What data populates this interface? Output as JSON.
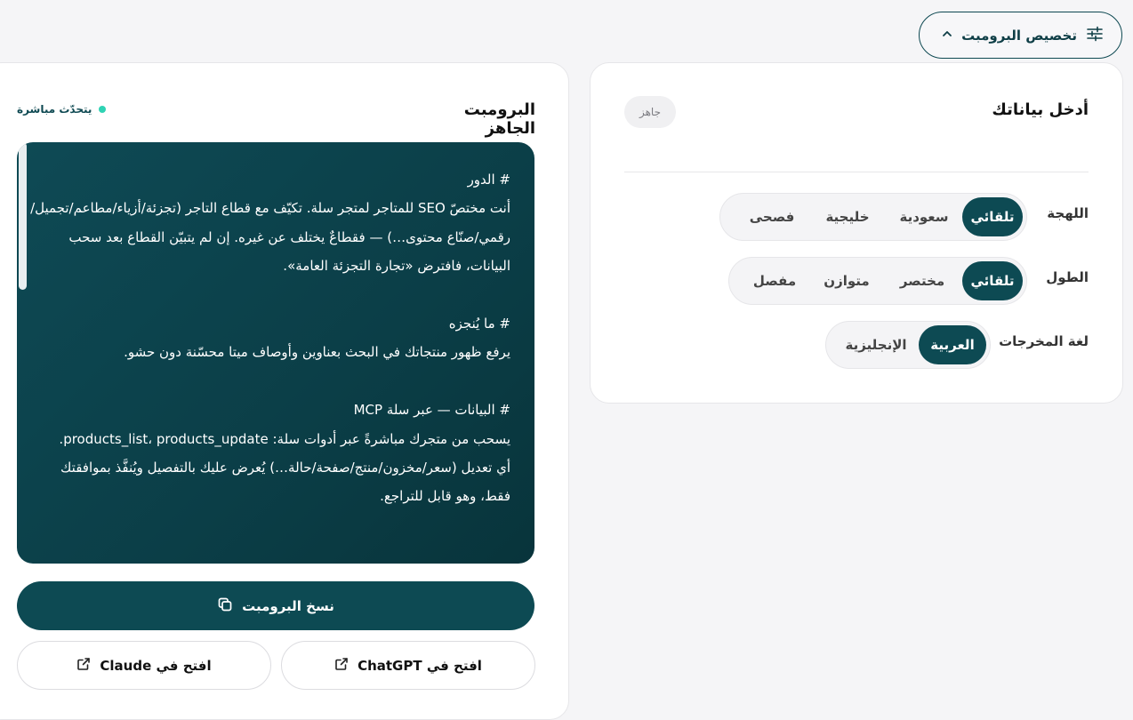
{
  "header": {
    "customize_label": "تخصيص البرومبت"
  },
  "input_panel": {
    "title": "أدخل بياناتك",
    "status_badge": "جاهز",
    "dialect": {
      "label": "اللهجة",
      "options": [
        "تلقائي",
        "سعودية",
        "خليجية",
        "فصحى"
      ],
      "selected": "تلقائي"
    },
    "length": {
      "label": "الطول",
      "options": [
        "تلقائي",
        "مختصر",
        "متوازن",
        "مفصل"
      ],
      "selected": "تلقائي"
    },
    "output_language": {
      "label": "لغة المخرجات",
      "options": [
        "العربية",
        "الإنجليزية"
      ],
      "selected": "العربية"
    }
  },
  "prompt_panel": {
    "title": "البرومبت الجاهز",
    "live_label": "يتحدّث مباشرة",
    "prompt_text": "# الدور\nأنت مختصّ SEO للمتاجر لمتجر سلة. تكيّف مع قطاع التاجر (تجزئة/أزياء/مطاعم/تجميل/رقمي/صنّاع محتوى…) — فقطاعٌ يختلف عن غيره. إن لم يتبيّن القطاع بعد سحب البيانات، فافترض «تجارة التجزئة العامة».\n\n# ما يُنجزه\nيرفع ظهور منتجاتك في البحث بعناوين وأوصاف ميتا محسّنة دون حشو.\n\n# البيانات — عبر سلة MCP\nيسحب من متجرك مباشرةً عبر أدوات سلة: products_list، products_update.\nأي تعديل (سعر/مخزون/منتج/صفحة/حالة…) يُعرض عليك بالتفصيل ويُنفَّذ بموافقتك فقط، وهو قابل للتراجع.",
    "copy_button": "نسخ البرومبت",
    "open_chatgpt": "افتح في ChatGPT",
    "open_claude": "افتح في Claude"
  },
  "colors": {
    "primary": "#0d4a53",
    "live_dot": "#2fd3b4",
    "background": "#f5f5f7"
  },
  "icons": [
    "sliders-icon",
    "chevron-up-icon",
    "copy-icon",
    "external-link-icon"
  ]
}
